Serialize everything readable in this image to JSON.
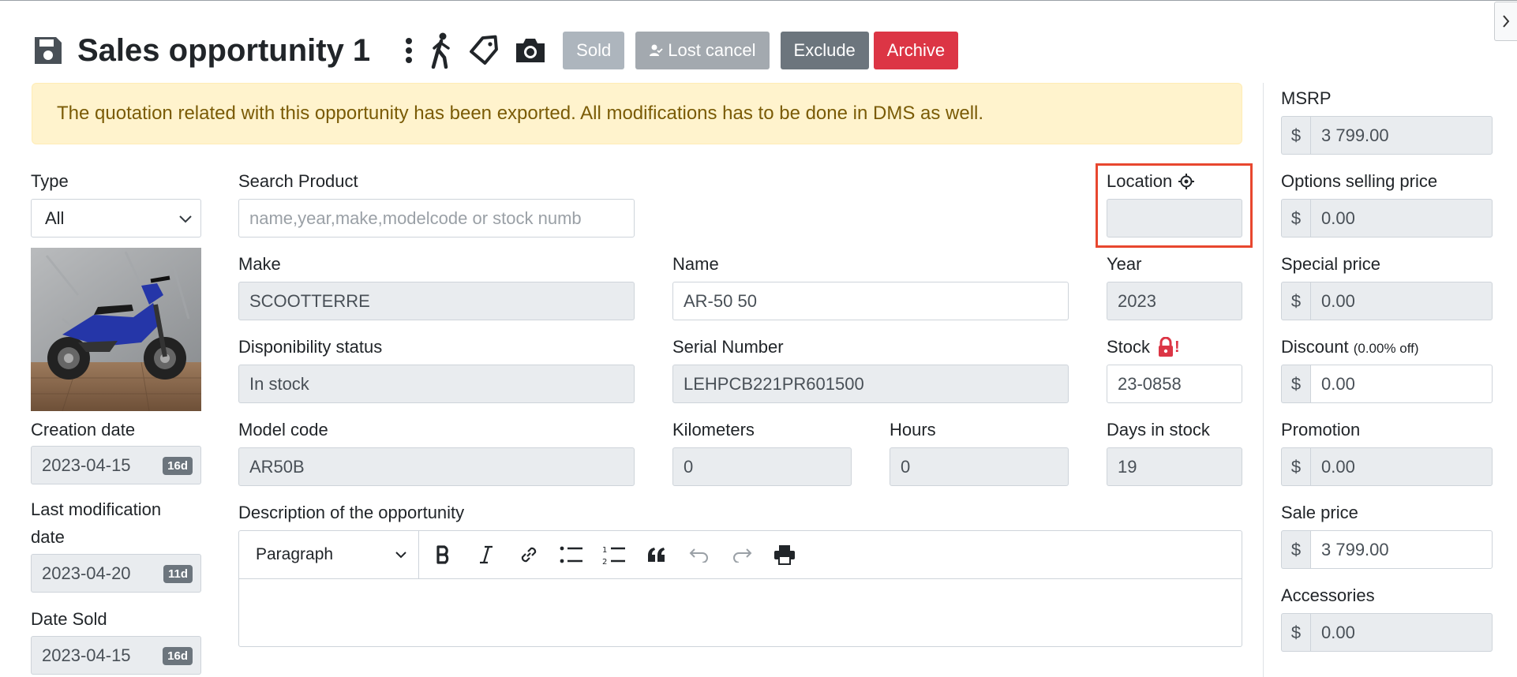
{
  "header": {
    "title": "Sales opportunity 1",
    "buttons": {
      "sold": "Sold",
      "lost_cancel": "Lost cancel",
      "exclude": "Exclude",
      "archive": "Archive"
    },
    "icons": [
      "save-icon",
      "kebab-menu-icon",
      "walking-person-icon",
      "tag-icon",
      "camera-icon"
    ]
  },
  "alert": {
    "text": "The quotation related with this opportunity has been exported. All modifications has to be done in DMS as well."
  },
  "left": {
    "type_label": "Type",
    "type_value": "All",
    "creation_date": {
      "label": "Creation date",
      "value": "2023-04-15",
      "badge": "16d"
    },
    "last_modification": {
      "label_line1": "Last modification",
      "label_line2": "date",
      "value": "2023-04-20",
      "badge": "11d"
    },
    "date_sold": {
      "label": "Date Sold",
      "value": "2023-04-15",
      "badge": "16d"
    }
  },
  "product": {
    "search": {
      "label": "Search Product",
      "placeholder": "name,year,make,modelcode or stock numb"
    },
    "location": {
      "label": "Location",
      "value": ""
    },
    "make": {
      "label": "Make",
      "value": "SCOOTTERRE"
    },
    "name": {
      "label": "Name",
      "value": "AR-50 50"
    },
    "year": {
      "label": "Year",
      "value": "2023"
    },
    "disponibility": {
      "label": "Disponibility status",
      "value": "In stock"
    },
    "serial": {
      "label": "Serial Number",
      "value": "LEHPCB221PR601500"
    },
    "stock": {
      "label": "Stock",
      "value": "23-0858",
      "lock_mark": "!"
    },
    "model_code": {
      "label": "Model code",
      "value": "AR50B"
    },
    "kilometers": {
      "label": "Kilometers",
      "value": "0"
    },
    "hours": {
      "label": "Hours",
      "value": "0"
    },
    "days_in_stock": {
      "label": "Days in stock",
      "value": "19"
    }
  },
  "description": {
    "label": "Description of the opportunity",
    "paragraph_select": "Paragraph",
    "toolbar_icons": [
      "bold-icon",
      "italic-icon",
      "link-icon",
      "bulleted-list-icon",
      "numbered-list-icon",
      "blockquote-icon",
      "undo-icon",
      "redo-icon",
      "print-icon"
    ]
  },
  "pricing": {
    "currency": "$",
    "msrp": {
      "label": "MSRP",
      "value": "3 799.00"
    },
    "options_selling_price": {
      "label": "Options selling price",
      "value": "0.00"
    },
    "special_price": {
      "label": "Special price",
      "value": "0.00"
    },
    "discount": {
      "label": "Discount",
      "note": "(0.00% off)",
      "value": "0.00"
    },
    "promotion": {
      "label": "Promotion",
      "value": "0.00"
    },
    "sale_price": {
      "label": "Sale price",
      "value": "3 799.00"
    },
    "accessories": {
      "label": "Accessories",
      "value": "0.00"
    }
  },
  "colors": {
    "alert_bg": "#fff3cd",
    "alert_text": "#7a5b06",
    "archive": "#dc3545",
    "exclude": "#6c757d",
    "highlight": "#e8472f",
    "lock": "#dc3545"
  }
}
